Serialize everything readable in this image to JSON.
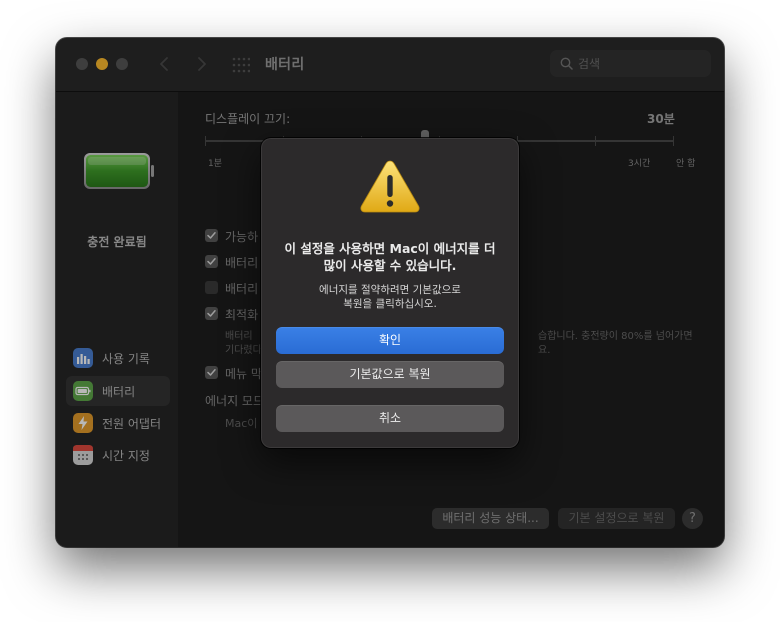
{
  "window": {
    "title": "배터리",
    "search_placeholder": "검색",
    "traffic_lights": [
      "close",
      "minimize",
      "zoom"
    ],
    "nav_icons": [
      "chevron-left-icon",
      "chevron-right-icon",
      "grid-icon"
    ]
  },
  "sidebar": {
    "battery_status": "충전 완료됨",
    "battery_level": 1.0,
    "items": [
      {
        "label": "사용 기록",
        "icon": "bar-chart-icon",
        "color": "#4a7fd0",
        "selected": false
      },
      {
        "label": "배터리",
        "icon": "battery-icon",
        "color": "#5fa84a",
        "selected": true
      },
      {
        "label": "전원 어댑터",
        "icon": "bolt-icon",
        "color": "#e39b2c",
        "selected": false
      },
      {
        "label": "시간 지정",
        "icon": "calendar-icon",
        "color": "#d9d9d9",
        "selected": false
      }
    ]
  },
  "main": {
    "display_off_label": "디스플레이 끄기:",
    "display_off_value": "30분",
    "slider_ticks": [
      "1분",
      "3시간",
      "안 함"
    ],
    "checkboxes": [
      {
        "label": "가능하",
        "checked": true
      },
      {
        "label": "배터리",
        "checked": true
      },
      {
        "label": "배터리",
        "checked": false
      },
      {
        "label": "최적화",
        "checked": true
      },
      {
        "label": "메뉴 막",
        "checked": true
      }
    ],
    "optimize_desc_left_1": "배터리",
    "optimize_desc_left_2": "기다렸다",
    "optimize_desc_right_1": "습합니다. 충전량이 80%를 넘어가면",
    "optimize_desc_right_2": "요.",
    "energy_mode_label": "에너지 모드",
    "energy_mode_desc": "Mac이",
    "battery_health_button": "배터리 성능 상태...",
    "restore_defaults_button": "기본 설정으로 복원",
    "help_button": "?"
  },
  "dialog": {
    "title_line1": "이 설정을 사용하면 Mac이 에너지를 더",
    "title_line2": "많이 사용할 수 있습니다.",
    "message_line1": "에너지를 절약하려면 기본값으로",
    "message_line2": "복원을 클릭하십시오.",
    "confirm_button": "확인",
    "restore_button": "기본값으로 복원",
    "cancel_button": "취소",
    "accent_color": "#2f74dc"
  }
}
